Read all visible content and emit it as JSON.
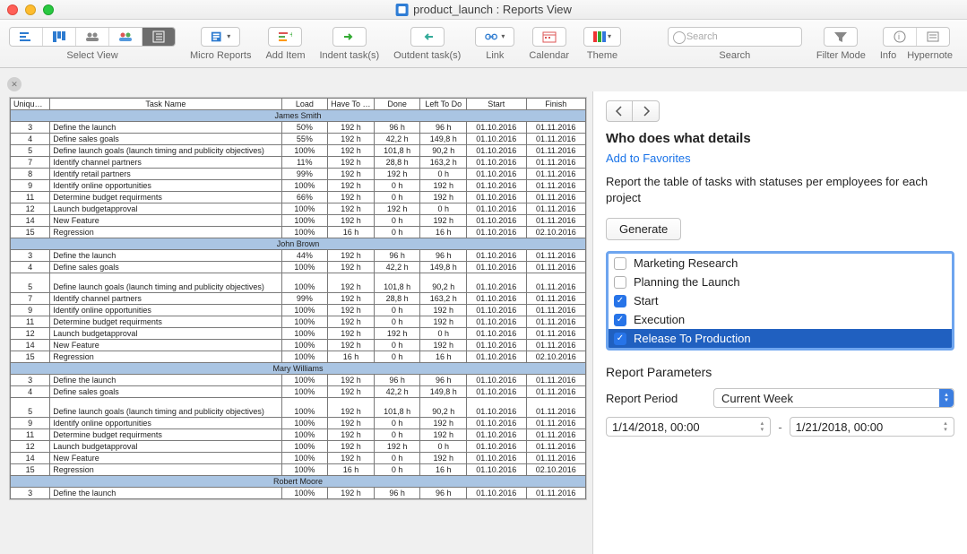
{
  "window": {
    "title": "product_launch : Reports View"
  },
  "toolbar": {
    "select_view": "Select View",
    "micro_reports": "Micro Reports",
    "add_item": "Add Item",
    "indent": "Indent task(s)",
    "outdent": "Outdent task(s)",
    "link": "Link",
    "calendar": "Calendar",
    "theme": "Theme",
    "search_placeholder": "Search",
    "search_label": "Search",
    "filter_mode": "Filter Mode",
    "info": "Info",
    "hypernote": "Hypernote"
  },
  "table": {
    "headers": {
      "uid": "Unique ID",
      "name": "Task Name",
      "load": "Load",
      "have": "Have To Do",
      "done": "Done",
      "left": "Left To Do",
      "start": "Start",
      "finish": "Finish"
    },
    "groups": [
      {
        "person": "James Smith",
        "rows": [
          {
            "id": "3",
            "name": "Define the launch",
            "load": "50%",
            "have": "192 h",
            "done": "96 h",
            "left": "96 h",
            "start": "01.10.2016",
            "finish": "01.11.2016",
            "tall": false
          },
          {
            "id": "4",
            "name": "Define sales goals",
            "load": "55%",
            "have": "192 h",
            "done": "42,2 h",
            "left": "149,8 h",
            "start": "01.10.2016",
            "finish": "01.11.2016",
            "tall": false
          },
          {
            "id": "5",
            "name": "Define launch goals (launch timing and publicity objectives)",
            "load": "100%",
            "have": "192 h",
            "done": "101,8 h",
            "left": "90,2 h",
            "start": "01.10.2016",
            "finish": "01.11.2016",
            "tall": false
          },
          {
            "id": "7",
            "name": "Identify channel partners",
            "load": "11%",
            "have": "192 h",
            "done": "28,8 h",
            "left": "163,2 h",
            "start": "01.10.2016",
            "finish": "01.11.2016",
            "tall": false
          },
          {
            "id": "8",
            "name": "Identify retail partners",
            "load": "99%",
            "have": "192 h",
            "done": "192 h",
            "left": "0 h",
            "start": "01.10.2016",
            "finish": "01.11.2016",
            "tall": false
          },
          {
            "id": "9",
            "name": "Identify online opportunities",
            "load": "100%",
            "have": "192 h",
            "done": "0 h",
            "left": "192 h",
            "start": "01.10.2016",
            "finish": "01.11.2016",
            "tall": false
          },
          {
            "id": "11",
            "name": "Determine budget requirments",
            "load": "66%",
            "have": "192 h",
            "done": "0 h",
            "left": "192 h",
            "start": "01.10.2016",
            "finish": "01.11.2016",
            "tall": false
          },
          {
            "id": "12",
            "name": "Launch budgetapproval",
            "load": "100%",
            "have": "192 h",
            "done": "192 h",
            "left": "0 h",
            "start": "01.10.2016",
            "finish": "01.11.2016",
            "tall": false
          },
          {
            "id": "14",
            "name": "New Feature",
            "load": "100%",
            "have": "192 h",
            "done": "0 h",
            "left": "192 h",
            "start": "01.10.2016",
            "finish": "01.11.2016",
            "tall": false
          },
          {
            "id": "15",
            "name": "Regression",
            "load": "100%",
            "have": "16 h",
            "done": "0 h",
            "left": "16 h",
            "start": "01.10.2016",
            "finish": "02.10.2016",
            "tall": false
          }
        ]
      },
      {
        "person": "John Brown",
        "rows": [
          {
            "id": "3",
            "name": "Define the launch",
            "load": "44%",
            "have": "192 h",
            "done": "96 h",
            "left": "96 h",
            "start": "01.10.2016",
            "finish": "01.11.2016",
            "tall": false
          },
          {
            "id": "4",
            "name": "Define sales goals",
            "load": "100%",
            "have": "192 h",
            "done": "42,2 h",
            "left": "149,8 h",
            "start": "01.10.2016",
            "finish": "01.11.2016",
            "tall": false
          },
          {
            "id": "5",
            "name": "Define launch goals (launch timing and publicity objectives)",
            "load": "100%",
            "have": "192 h",
            "done": "101,8 h",
            "left": "90,2 h",
            "start": "01.10.2016",
            "finish": "01.11.2016",
            "tall": true
          },
          {
            "id": "7",
            "name": "Identify channel partners",
            "load": "99%",
            "have": "192 h",
            "done": "28,8 h",
            "left": "163,2 h",
            "start": "01.10.2016",
            "finish": "01.11.2016",
            "tall": false
          },
          {
            "id": "9",
            "name": "Identify online opportunities",
            "load": "100%",
            "have": "192 h",
            "done": "0 h",
            "left": "192 h",
            "start": "01.10.2016",
            "finish": "01.11.2016",
            "tall": false
          },
          {
            "id": "11",
            "name": "Determine budget requirments",
            "load": "100%",
            "have": "192 h",
            "done": "0 h",
            "left": "192 h",
            "start": "01.10.2016",
            "finish": "01.11.2016",
            "tall": false
          },
          {
            "id": "12",
            "name": "Launch budgetapproval",
            "load": "100%",
            "have": "192 h",
            "done": "192 h",
            "left": "0 h",
            "start": "01.10.2016",
            "finish": "01.11.2016",
            "tall": false
          },
          {
            "id": "14",
            "name": "New Feature",
            "load": "100%",
            "have": "192 h",
            "done": "0 h",
            "left": "192 h",
            "start": "01.10.2016",
            "finish": "01.11.2016",
            "tall": false
          },
          {
            "id": "15",
            "name": "Regression",
            "load": "100%",
            "have": "16 h",
            "done": "0 h",
            "left": "16 h",
            "start": "01.10.2016",
            "finish": "02.10.2016",
            "tall": false
          }
        ]
      },
      {
        "person": "Mary Williams",
        "rows": [
          {
            "id": "3",
            "name": "Define the launch",
            "load": "100%",
            "have": "192 h",
            "done": "96 h",
            "left": "96 h",
            "start": "01.10.2016",
            "finish": "01.11.2016",
            "tall": false
          },
          {
            "id": "4",
            "name": "Define sales goals",
            "load": "100%",
            "have": "192 h",
            "done": "42,2 h",
            "left": "149,8 h",
            "start": "01.10.2016",
            "finish": "01.11.2016",
            "tall": false
          },
          {
            "id": "5",
            "name": "Define launch goals (launch timing and publicity objectives)",
            "load": "100%",
            "have": "192 h",
            "done": "101,8 h",
            "left": "90,2 h",
            "start": "01.10.2016",
            "finish": "01.11.2016",
            "tall": true
          },
          {
            "id": "9",
            "name": "Identify online opportunities",
            "load": "100%",
            "have": "192 h",
            "done": "0 h",
            "left": "192 h",
            "start": "01.10.2016",
            "finish": "01.11.2016",
            "tall": false
          },
          {
            "id": "11",
            "name": "Determine budget requirments",
            "load": "100%",
            "have": "192 h",
            "done": "0 h",
            "left": "192 h",
            "start": "01.10.2016",
            "finish": "01.11.2016",
            "tall": false
          },
          {
            "id": "12",
            "name": "Launch budgetapproval",
            "load": "100%",
            "have": "192 h",
            "done": "192 h",
            "left": "0 h",
            "start": "01.10.2016",
            "finish": "01.11.2016",
            "tall": false
          },
          {
            "id": "14",
            "name": "New Feature",
            "load": "100%",
            "have": "192 h",
            "done": "0 h",
            "left": "192 h",
            "start": "01.10.2016",
            "finish": "01.11.2016",
            "tall": false
          },
          {
            "id": "15",
            "name": "Regression",
            "load": "100%",
            "have": "16 h",
            "done": "0 h",
            "left": "16 h",
            "start": "01.10.2016",
            "finish": "02.10.2016",
            "tall": false
          }
        ]
      },
      {
        "person": "Robert Moore",
        "rows": [
          {
            "id": "3",
            "name": "Define the launch",
            "load": "100%",
            "have": "192 h",
            "done": "96 h",
            "left": "96 h",
            "start": "01.10.2016",
            "finish": "01.11.2016",
            "tall": false
          }
        ]
      }
    ]
  },
  "panel": {
    "title": "Who does what details",
    "favorites": "Add to Favorites",
    "desc": "Report the table of tasks with statuses per employees for each project",
    "generate": "Generate",
    "categories": [
      {
        "label": "Marketing Research",
        "checked": false,
        "selected": false
      },
      {
        "label": "Planning the Launch",
        "checked": false,
        "selected": false
      },
      {
        "label": "Start",
        "checked": true,
        "selected": false
      },
      {
        "label": "Execution",
        "checked": true,
        "selected": false
      },
      {
        "label": "Release To Production",
        "checked": true,
        "selected": true
      }
    ],
    "params_title": "Report Parameters",
    "period_label": "Report Period",
    "period_value": "Current Week",
    "date_from": "1/14/2018, 00:00",
    "date_to": "1/21/2018, 00:00",
    "dash": "-"
  }
}
